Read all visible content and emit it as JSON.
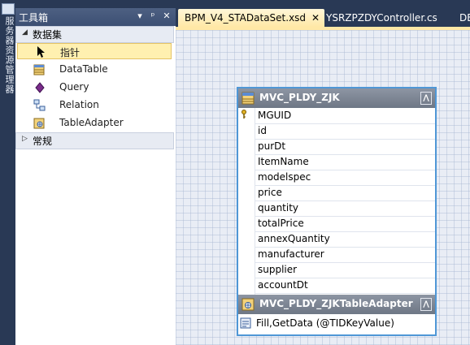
{
  "left_strip": {
    "text": "服务器资源管理器"
  },
  "toolbox": {
    "title": "工具箱",
    "groups": [
      {
        "label": "数据集",
        "expanded": true
      },
      {
        "label": "常规",
        "expanded": false
      }
    ],
    "items": [
      {
        "label": "指针",
        "icon": "pointer-icon",
        "selected": true
      },
      {
        "label": "DataTable",
        "icon": "datatable-icon"
      },
      {
        "label": "Query",
        "icon": "query-icon"
      },
      {
        "label": "Relation",
        "icon": "relation-icon"
      },
      {
        "label": "TableAdapter",
        "icon": "tableadapter-icon"
      }
    ],
    "buttons": {
      "dropdown": "▾",
      "pin": "ᵖ",
      "close": "✕"
    }
  },
  "tabs": [
    {
      "label": "BPM_V4_STADataSet.xsd",
      "active": true,
      "close": "✕"
    },
    {
      "label": "YSRZPZDYController.cs",
      "active": false
    },
    {
      "label": "DE",
      "active": false
    }
  ],
  "datatable": {
    "name": "MVC_PLDY_ZJK",
    "collapse_glyph": "⋀",
    "columns": [
      "MGUID",
      "id",
      "purDt",
      "ItemName",
      "modelspec",
      "price",
      "quantity",
      "totalPrice",
      "annexQuantity",
      "manufacturer",
      "supplier",
      "accountDt"
    ]
  },
  "tableadapter": {
    "name": "MVC_PLDY_ZJKTableAdapter",
    "collapse_glyph": "⋀",
    "query": "Fill,GetData (@TIDKeyValue)"
  },
  "colors": {
    "chrome": "#293955",
    "selected_item": "#fff0b0",
    "active_tab": "#ffe8a6",
    "datatable_border": "#4f97d6"
  }
}
